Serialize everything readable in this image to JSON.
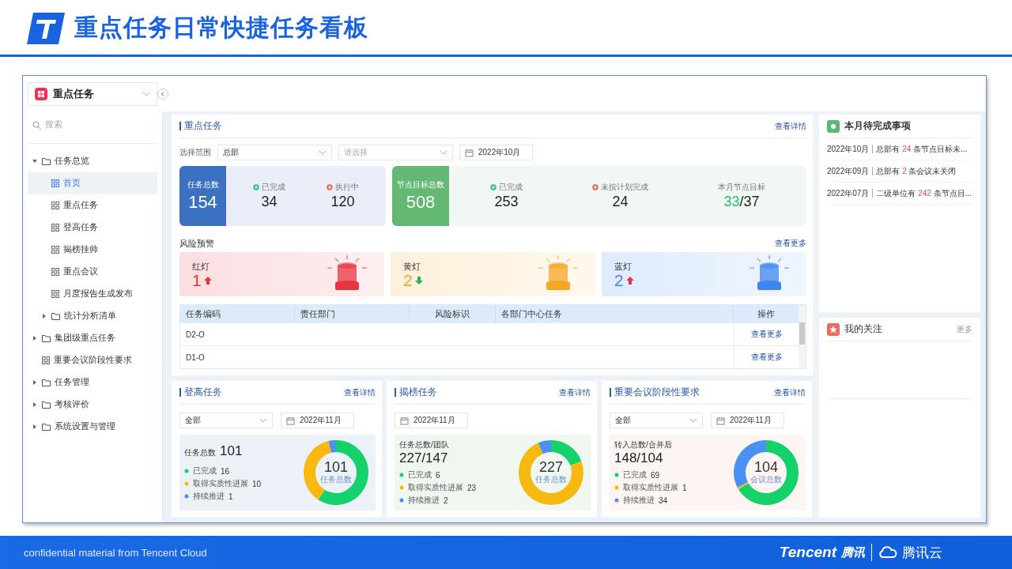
{
  "slide": {
    "title": "重点任务日常快捷任务看板",
    "footer": "confidential material from Tencent Cloud",
    "brand": {
      "latin": "Tencent",
      "cjk": "腾讯",
      "cloud": "腾讯云"
    }
  },
  "sidebar": {
    "app": "重点任务",
    "search_placeholder": "搜索",
    "items": [
      {
        "label": "任务总览",
        "kind": "folder",
        "expanded": true,
        "selected": false,
        "children": [
          {
            "label": "首页",
            "kind": "page",
            "selected": true
          },
          {
            "label": "重点任务",
            "kind": "page",
            "selected": false
          },
          {
            "label": "登高任务",
            "kind": "page",
            "selected": false
          },
          {
            "label": "揭榜挂帅",
            "kind": "page",
            "selected": false
          },
          {
            "label": "重点会议",
            "kind": "page",
            "selected": false
          },
          {
            "label": "月度报告生成发布",
            "kind": "page",
            "selected": false
          },
          {
            "label": "统计分析清单",
            "kind": "folder",
            "expanded": false,
            "selected": false
          }
        ]
      },
      {
        "label": "集团级重点任务",
        "kind": "folder",
        "expanded": false,
        "selected": false
      },
      {
        "label": "重要会议阶段性要求",
        "kind": "page",
        "selected": false
      },
      {
        "label": "任务管理",
        "kind": "folder",
        "expanded": false,
        "selected": false
      },
      {
        "label": "考核评价",
        "kind": "folder",
        "expanded": false,
        "selected": false
      },
      {
        "label": "系统设置与管理",
        "kind": "folder",
        "expanded": false,
        "selected": false
      }
    ]
  },
  "key_tasks": {
    "title": "重点任务",
    "link": "查看详情",
    "scope_label": "选择范围",
    "scope": "总部",
    "second_placeholder": "请选择",
    "date": "2022年10月",
    "task_summary": {
      "label": "任务总数",
      "value": "154",
      "stats": [
        {
          "label": "已完成",
          "value": "34",
          "color": "#1fc77a"
        },
        {
          "label": "执行中",
          "value": "120",
          "color": "#f0644f"
        }
      ]
    },
    "node_summary": {
      "label": "节点目标总数",
      "value": "508",
      "stats": [
        {
          "label": "已完成",
          "value": "253",
          "color": "#1fc77a"
        },
        {
          "label": "未按计划完成",
          "value": "24",
          "color": "#f0644f"
        }
      ],
      "target": {
        "label": "本月节点目标",
        "done": "33",
        "rest": "/37"
      }
    }
  },
  "risk": {
    "title": "风险预警",
    "link": "查看更多",
    "lights": [
      {
        "label": "红灯",
        "count": "1",
        "rising": true,
        "color": "#e8343f"
      },
      {
        "label": "黄灯",
        "count": "2",
        "rising": false,
        "color": "#f5a623"
      },
      {
        "label": "蓝灯",
        "count": "2",
        "rising": true,
        "color": "#3d86f0"
      }
    ]
  },
  "table": {
    "columns": [
      "任务编码",
      "责任部门",
      "风险标识",
      "各部门中心任务",
      "操作"
    ],
    "rows": [
      {
        "code": "D2-O",
        "action": "查看更多"
      },
      {
        "code": "D1-O",
        "action": "查看更多"
      }
    ]
  },
  "panels": [
    {
      "title": "登高任务",
      "link": "查看详情",
      "filter": "全部",
      "date": "2022年11月",
      "kind": "inline",
      "summary_label": "任务总数",
      "summary_value": "101",
      "center_value": "101",
      "center_label": "任务总数",
      "legend": [
        {
          "label": "已完成",
          "value": "16",
          "color": "#14d16a"
        },
        {
          "label": "取得实质性进展",
          "value": "10",
          "color": "#f7b90f"
        },
        {
          "label": "持续推进",
          "value": "1",
          "color": "#4a90f5"
        }
      ],
      "chart_data": {
        "type": "donut",
        "values": [
          59.3,
          37.0,
          3.7
        ]
      }
    },
    {
      "title": "揭榜任务",
      "link": "查看详情",
      "date": "2022年11月",
      "kind": "stacked",
      "summary_label": "任务总数/团队",
      "summary_value": "227/147",
      "center_value": "227",
      "center_label": "任务总数",
      "legend": [
        {
          "label": "已完成",
          "value": "6",
          "color": "#14d16a"
        },
        {
          "label": "取得实质性进展",
          "value": "23",
          "color": "#f7b90f"
        },
        {
          "label": "持续推进",
          "value": "2",
          "color": "#4a90f5"
        }
      ],
      "chart_data": {
        "type": "donut",
        "values": [
          19.3,
          74.2,
          6.5
        ]
      }
    },
    {
      "title": "重要会议阶段性要求",
      "link": "查看详情",
      "filter": "全部",
      "date": "2022年11月",
      "kind": "stacked",
      "summary_label": "转入总数/合并后",
      "summary_value": "148/104",
      "center_value": "104",
      "center_label": "会议总数",
      "legend": [
        {
          "label": "已完成",
          "value": "69",
          "color": "#14d16a"
        },
        {
          "label": "取得实质性进展",
          "value": "1",
          "color": "#f7b90f"
        },
        {
          "label": "持续推进",
          "value": "34",
          "color": "#4a90f5"
        }
      ],
      "chart_data": {
        "type": "donut",
        "values": [
          66.3,
          1.0,
          32.7
        ]
      }
    }
  ],
  "todo": {
    "title": "本月待完成事项",
    "items": [
      {
        "date": "2022年10月",
        "prefix": "总部有",
        "count": "24",
        "suffix": "条节点目标未..."
      },
      {
        "date": "2022年09月",
        "prefix": "总部有",
        "count": "2",
        "suffix": "条会议未关闭"
      },
      {
        "date": "2022年07月",
        "prefix": "二级单位有",
        "count": "242",
        "suffix": "条节点目..."
      }
    ]
  },
  "follow": {
    "title": "我的关注",
    "link": "更多"
  }
}
